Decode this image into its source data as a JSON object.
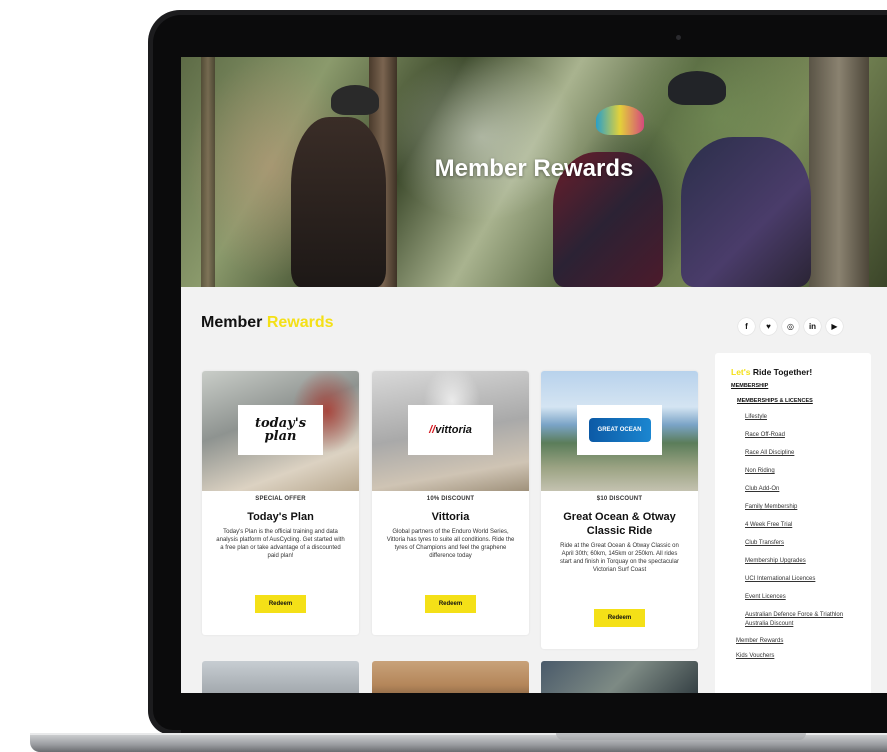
{
  "hero": {
    "title": "Member Rewards"
  },
  "section": {
    "title_main": "Member",
    "title_accent": "Rewards"
  },
  "socials": [
    {
      "icon": "facebook-icon",
      "glyph": "f"
    },
    {
      "icon": "twitter-icon",
      "glyph": "♥"
    },
    {
      "icon": "instagram-icon",
      "glyph": "◎"
    },
    {
      "icon": "linkedin-icon",
      "glyph": "in"
    },
    {
      "icon": "youtube-icon",
      "glyph": "▶"
    }
  ],
  "cards": [
    {
      "logo": "today's plan",
      "badge": "SPECIAL OFFER",
      "title": "Today's Plan",
      "desc": "Today's Plan is the official training and data analysis platform of AusCycling. Get started with a free plan or take advantage of a discounted paid plan!",
      "button": "Redeem"
    },
    {
      "logo": "vittoria",
      "badge": "10% DISCOUNT",
      "title": "Vittoria",
      "desc": "Global partners of the Enduro World Series, Vittoria has tyres to suite all conditions. Ride the tyres of Champions and feel the graphene difference today",
      "button": "Redeem"
    },
    {
      "logo": "GREAT OCEAN",
      "badge": "$10 DISCOUNT",
      "title": "Great Ocean & Otway Classic Ride",
      "desc": "Ride at the Great Ocean & Otway Classic on April 30th; 60km, 145km or 250km. All rides start and finish in Torquay on the spectacular Victorian Surf Coast",
      "button": "Redeem"
    }
  ],
  "sidebar": {
    "title_accent": "Let's",
    "title_main": "Ride Together!",
    "membership": "MEMBERSHIP",
    "memberships_licences": "MEMBERSHIPS & LICENCES",
    "items": [
      "Lifestyle",
      "Race Off-Road",
      "Race All Discipline",
      "Non Riding",
      "Club Add-On",
      "Family Membership",
      "4 Week Free Trial",
      "Club Transfers",
      "Membership Upgrades",
      "UCI International Licences",
      "Event Licences",
      "Australian Defence Force & Triathlon Australia Discount"
    ],
    "member_rewards": "Member Rewards",
    "kids_vouchers": "Kids Vouchers"
  },
  "colors": {
    "accent": "#f4e017",
    "background": "#f2f2f2",
    "laptop": "#1c1c1e"
  }
}
